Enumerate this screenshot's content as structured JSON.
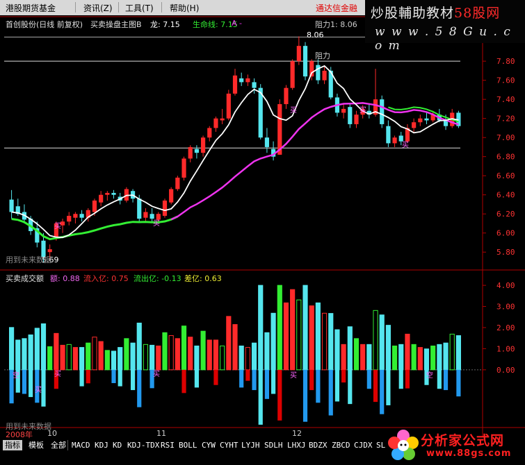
{
  "menu": {
    "items": [
      "港股期货基金",
      "资讯(Z)",
      "工具(T)",
      "帮助(H)"
    ],
    "right_label": "通达信金融"
  },
  "watermark": {
    "title_prefix": "炒股輔助教材",
    "title_red": "58",
    "title_suffix": "股网",
    "url": "w w w . 5 8 G u . c o m",
    "bottom_text": "分析家公式网",
    "bottom_url": "www.88gs.com"
  },
  "main_panel": {
    "stock_label": "首创股份(日线 前复权)",
    "indicator_name": "买卖操盘主图B",
    "dragon_label": "龙: 7.15",
    "lifeline_label": "生命线: 7.15",
    "arrow_label": "A -",
    "resistance_label": "阻力1: 8.06",
    "resistance_short": "阻力",
    "high_mark": "8.06",
    "low_mark": "5.69",
    "unused_label": "用到未来数据",
    "buy_label": "买"
  },
  "sub_panel": {
    "indicator_name": "买卖成交额",
    "amount_label": "额: 0.88",
    "inflow_label": "流入亿: 0.75",
    "outflow_label": "流出亿: -0.13",
    "diff_label": "差亿: 0.63",
    "unused_label": "用到未来数据",
    "buy_label": "买",
    "short_label": "空"
  },
  "date_axis": {
    "year_label": "2008年",
    "months": [
      "10",
      "11",
      "12"
    ]
  },
  "tabs": [
    "指标",
    "模板",
    "全部",
    "MACD",
    "KDJ",
    "KD",
    "KDJ-TDX",
    "RSI",
    "BOLL",
    "CYW",
    "CYHT",
    "LYJH",
    "SDLH",
    "LHXJ",
    "BDZX",
    "ZBCD",
    "CJDX",
    "SL"
  ],
  "colors": {
    "up": "#ff2a2a",
    "down": "#55e6ee",
    "lifeline": "#ee33ee",
    "dragon": "#ffffff",
    "green": "#33ee33",
    "axis": "#b00000"
  },
  "chart_data": [
    {
      "type": "candlestick",
      "title": "买卖操盘主图B",
      "y_ticks": [
        5.8,
        6.0,
        6.2,
        6.4,
        6.6,
        6.8,
        7.0,
        7.2,
        7.4,
        7.6,
        7.8
      ],
      "ylim": [
        5.62,
        8.15
      ],
      "resistance_lines": [
        7.8,
        6.89
      ],
      "candles": [
        [
          6.35,
          6.45,
          6.15,
          6.22
        ],
        [
          6.28,
          6.36,
          6.18,
          6.2
        ],
        [
          6.22,
          6.3,
          6.1,
          6.14
        ],
        [
          6.15,
          6.18,
          5.98,
          6.02
        ],
        [
          6.05,
          6.12,
          5.85,
          5.9
        ],
        [
          5.92,
          6.0,
          5.69,
          5.75
        ],
        [
          5.8,
          5.88,
          5.74,
          5.83
        ],
        [
          5.95,
          6.12,
          5.92,
          6.1
        ],
        [
          6.08,
          6.15,
          6.0,
          6.12
        ],
        [
          6.12,
          6.22,
          6.08,
          6.18
        ],
        [
          6.16,
          6.22,
          6.1,
          6.2
        ],
        [
          6.2,
          6.24,
          6.12,
          6.16
        ],
        [
          6.16,
          6.26,
          6.12,
          6.24
        ],
        [
          6.22,
          6.36,
          6.18,
          6.34
        ],
        [
          6.32,
          6.44,
          6.28,
          6.4
        ],
        [
          6.4,
          6.44,
          6.34,
          6.42
        ],
        [
          6.42,
          6.45,
          6.36,
          6.4
        ],
        [
          6.38,
          6.42,
          6.3,
          6.34
        ],
        [
          6.34,
          6.48,
          6.32,
          6.46
        ],
        [
          6.44,
          6.46,
          6.32,
          6.36
        ],
        [
          6.36,
          6.4,
          6.12,
          6.15
        ],
        [
          6.16,
          6.26,
          6.12,
          6.22
        ],
        [
          6.2,
          6.26,
          6.12,
          6.15
        ],
        [
          6.14,
          6.22,
          6.1,
          6.2
        ],
        [
          6.18,
          6.36,
          6.16,
          6.34
        ],
        [
          6.32,
          6.48,
          6.3,
          6.46
        ],
        [
          6.46,
          6.6,
          6.44,
          6.58
        ],
        [
          6.58,
          6.8,
          6.55,
          6.78
        ],
        [
          6.78,
          6.92,
          6.74,
          6.9
        ],
        [
          6.88,
          6.92,
          6.78,
          6.84
        ],
        [
          6.84,
          7.02,
          6.8,
          7.0
        ],
        [
          7.0,
          7.12,
          6.96,
          7.1
        ],
        [
          7.1,
          7.22,
          7.06,
          7.2
        ],
        [
          7.18,
          7.3,
          7.14,
          7.2
        ],
        [
          7.2,
          7.5,
          7.18,
          7.46
        ],
        [
          7.46,
          7.72,
          7.44,
          7.65
        ],
        [
          7.62,
          7.68,
          7.54,
          7.58
        ],
        [
          7.58,
          7.66,
          7.54,
          7.62
        ],
        [
          7.58,
          7.62,
          7.46,
          7.52
        ],
        [
          7.52,
          7.56,
          6.98,
          7.0
        ],
        [
          7.0,
          7.1,
          6.84,
          6.9
        ],
        [
          6.88,
          6.96,
          6.76,
          6.8
        ],
        [
          6.82,
          7.4,
          6.82,
          7.35
        ],
        [
          7.35,
          7.55,
          7.3,
          7.52
        ],
        [
          7.52,
          7.82,
          7.5,
          7.8
        ],
        [
          7.8,
          8.06,
          7.76,
          7.96
        ],
        [
          7.96,
          8.0,
          7.6,
          7.64
        ],
        [
          7.64,
          7.82,
          7.6,
          7.8
        ],
        [
          7.76,
          7.82,
          7.56,
          7.6
        ],
        [
          7.6,
          7.74,
          7.56,
          7.7
        ],
        [
          7.7,
          7.74,
          7.4,
          7.42
        ],
        [
          7.42,
          7.46,
          7.22,
          7.26
        ],
        [
          7.26,
          7.36,
          7.2,
          7.3
        ],
        [
          7.32,
          7.36,
          7.1,
          7.14
        ],
        [
          7.14,
          7.28,
          7.1,
          7.24
        ],
        [
          7.24,
          7.34,
          7.2,
          7.3
        ],
        [
          7.28,
          7.36,
          7.2,
          7.24
        ],
        [
          7.24,
          7.72,
          7.22,
          7.4
        ],
        [
          7.4,
          7.44,
          7.1,
          7.14
        ],
        [
          7.12,
          7.18,
          6.9,
          6.94
        ],
        [
          6.94,
          7.02,
          6.9,
          7.0
        ],
        [
          7.02,
          7.06,
          6.92,
          6.96
        ],
        [
          6.96,
          7.14,
          6.94,
          7.1
        ],
        [
          7.1,
          7.2,
          7.06,
          7.16
        ],
        [
          7.16,
          7.24,
          7.12,
          7.2
        ],
        [
          7.2,
          7.26,
          7.14,
          7.18
        ],
        [
          7.18,
          7.28,
          7.16,
          7.24
        ],
        [
          7.24,
          7.3,
          7.16,
          7.18
        ],
        [
          7.18,
          7.24,
          7.08,
          7.12
        ],
        [
          7.12,
          7.3,
          7.1,
          7.26
        ],
        [
          7.26,
          7.28,
          7.1,
          7.12
        ]
      ]
    },
    {
      "type": "bar",
      "title": "买卖成交额",
      "y_ticks": [
        0.0,
        1.0,
        2.0,
        3.0,
        4.0
      ],
      "ylim": [
        -2.7,
        4.3
      ]
    }
  ]
}
